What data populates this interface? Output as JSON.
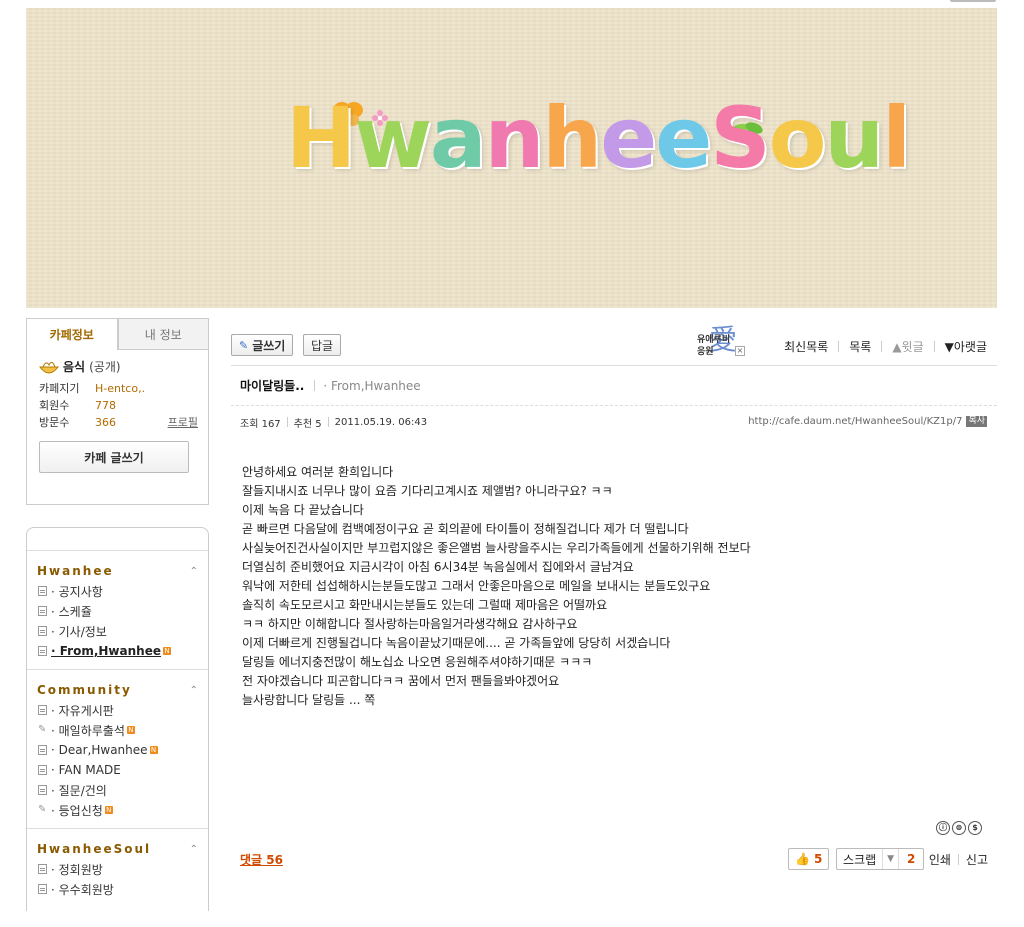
{
  "banner": {
    "logo_letters": [
      {
        "ch": "H",
        "color": "#f5c84a"
      },
      {
        "ch": "w",
        "color": "#9dd45a"
      },
      {
        "ch": "a",
        "color": "#6fcaa8"
      },
      {
        "ch": "n",
        "color": "#f07ab0"
      },
      {
        "ch": "h",
        "color": "#f7a64c"
      },
      {
        "ch": "e",
        "color": "#c39ae8"
      },
      {
        "ch": "e",
        "color": "#6ec9e8"
      },
      {
        "ch": "S",
        "color": "#f47aa8"
      },
      {
        "ch": "o",
        "color": "#f5c84a"
      },
      {
        "ch": "u",
        "color": "#9dd45a"
      },
      {
        "ch": "l",
        "color": "#f7a64c"
      }
    ]
  },
  "sidebar": {
    "tabs": {
      "cafe_info": "카페정보",
      "my_info": "내 정보"
    },
    "category": {
      "name": "음식",
      "visibility": "(공개)"
    },
    "info": {
      "manager_label": "카페지기",
      "manager_value": "H-entco,.",
      "members_label": "회원수",
      "members_value": "778",
      "visitors_label": "방문수",
      "visitors_value": "366",
      "profile_link": "프로필"
    },
    "write_button": "카페 글쓰기",
    "sections": [
      {
        "title": "Hwanhee",
        "items": [
          {
            "label": "· 공지사항",
            "icon": "list",
            "new": false,
            "active": false
          },
          {
            "label": "· 스케쥴",
            "icon": "list",
            "new": false,
            "active": false
          },
          {
            "label": "· 기사/정보",
            "icon": "list",
            "new": false,
            "active": false
          },
          {
            "label": "· From,Hwanhee",
            "icon": "list",
            "new": true,
            "active": true
          }
        ]
      },
      {
        "title": "Community",
        "items": [
          {
            "label": "· 자유게시판",
            "icon": "list",
            "new": false,
            "active": false
          },
          {
            "label": "· 매일하루출석",
            "icon": "pen",
            "new": true,
            "active": false
          },
          {
            "label": "· Dear,Hwanhee",
            "icon": "list",
            "new": true,
            "active": false
          },
          {
            "label": "· FAN MADE",
            "icon": "list",
            "new": false,
            "active": false
          },
          {
            "label": "· 질문/건의",
            "icon": "list",
            "new": false,
            "active": false
          },
          {
            "label": "· 등업신청",
            "icon": "pen",
            "new": true,
            "active": false
          }
        ]
      },
      {
        "title": "HwanheeSoul",
        "items": [
          {
            "label": "· 정회원방",
            "icon": "list",
            "new": false,
            "active": false
          },
          {
            "label": "· 우수회원방",
            "icon": "list",
            "new": false,
            "active": false
          }
        ]
      }
    ]
  },
  "toolbar": {
    "write": "글쓰기",
    "reply": "답글",
    "ad_line1": "유애루비",
    "ad_line2": "응원",
    "ad_char": "愛",
    "recent_list": "최신목록",
    "list": "목록",
    "prev": "▲윗글",
    "next": "▼아랫글"
  },
  "post": {
    "title": "마이달링들..",
    "category": "· From,Hwanhee",
    "views": "조회 167",
    "recommend": "추천 5",
    "date": "2011.05.19. 06:43",
    "url": "http://cafe.daum.net/HwanheeSoul/KZ1p/7",
    "copy_label": "복사",
    "body": [
      "안녕하세요 여러분 환희입니다",
      "잘들지내시죠 너무나 많이 요즘 기다리고계시죠 제앨범?   아니라구요? ㅋㅋ",
      "이제 녹음 다 끝났습니다",
      "곧 빠르면 다음달에 컴백예정이구요 곧 회의끝에 타이틀이 정해질겁니다 제가 더 떨립니다",
      "사실늦어진건사실이지만 부끄럽지않은 좋은앨범 늘사랑을주시는 우리가족들에게 선물하기위해 전보다",
      "더열심히 준비했어요 지금시각이 아침 6시34분 녹음실에서 집에와서 글남겨요",
      "워낙에 저한테 섭섭해하시는분들도많고 그래서 안좋은마음으로 메일을 보내시는 분들도있구요",
      "솔직히 속도모르시고 화만내시는분들도 있는데 그럴때 제마음은 어떨까요",
      "ㅋㅋ 하지만 이해합니다 절사랑하는마음일거라생각해요 감사하구요",
      "이제 더빠르게 진행될겁니다 녹음이끝났기때문에.... 곧 가족들앞에 당당히 서겠습니다",
      "달링들  에너지충전많이 해노십쇼 나오면 응원해주셔야하기때문 ㅋㅋㅋ",
      "전 자야겠습니다 피곤합니다ㅋㅋ 꿈에서 먼저 팬들을봐야겠어요",
      "늘사랑합니다 달링들  ...    쪽"
    ]
  },
  "footer": {
    "comments": "댓글 56",
    "likes": "5",
    "scrap_label": "스크랩",
    "scrap_count": "2",
    "print": "인쇄",
    "report": "신고",
    "license_icons": [
      "ⓘ",
      "⊜",
      "$"
    ]
  }
}
